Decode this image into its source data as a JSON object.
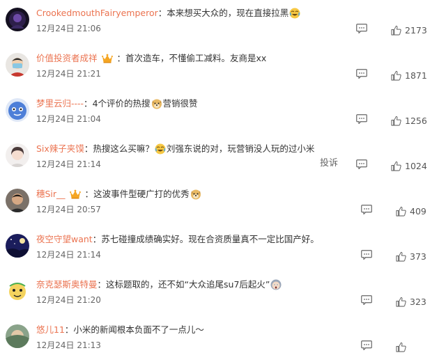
{
  "comments": [
    {
      "username": "CrookedmouthFairyemperor",
      "separator": "：",
      "text": "本来想买大众的，现在直接拉黑",
      "text_after": "",
      "emoji": "crying-laughing-emoji",
      "time": "12月24日 21:06",
      "likes": "2173",
      "has_crown": false
    },
    {
      "username": "价值投资者成祥",
      "separator": "：",
      "text": "首次造车，不懂偷工减料。友商是xx",
      "text_after": "",
      "emoji": "",
      "time": "12月24日 21:21",
      "likes": "1871",
      "has_crown": true
    },
    {
      "username": "梦里云归----",
      "separator": "：",
      "text": "4个评价的热搜",
      "text_after": "营销很赞",
      "emoji": "doge-emoji",
      "time": "12月24日 21:04",
      "likes": "1256",
      "has_crown": false
    },
    {
      "username": "Six辣子夹馍",
      "separator": "：",
      "text": "热搜这么买嘛？",
      "text_after": "刘强东说的对，玩营销没人玩的过小米",
      "emoji": "crying-laughing-emoji",
      "time": "12月24日 21:14",
      "likes": "1024",
      "has_crown": false,
      "report_label": "投诉"
    },
    {
      "username": "穗Sir__",
      "separator": "：",
      "text": "这波事件型硬广打的优秀",
      "text_after": "",
      "emoji": "doge-emoji",
      "time": "12月24日 20:57",
      "likes": "409",
      "has_crown": true
    },
    {
      "username": "夜空守望want",
      "separator": "：",
      "text": "苏七碰撞成绩确实好。现在合资质量真不一定比国产好。",
      "text_after": "",
      "emoji": "",
      "time": "12月24日 21:14",
      "likes": "373",
      "has_crown": false
    },
    {
      "username": "奈克瑟斯奥特曼",
      "separator": "：",
      "text": "这标题取的，还不如“大众追尾su7后起火”",
      "text_after": "",
      "emoji": "shocked-emoji",
      "time": "12月24日 21:20",
      "likes": "323",
      "has_crown": false
    },
    {
      "username": "悠儿11",
      "separator": "：",
      "text": "小米的新闻根本负面不了一点儿～",
      "text_after": "",
      "emoji": "",
      "time": "12月24日 21:13",
      "likes": "",
      "has_crown": false
    }
  ],
  "colors": {
    "username": "#eb7350",
    "text": "#333333",
    "meta": "#666666"
  }
}
